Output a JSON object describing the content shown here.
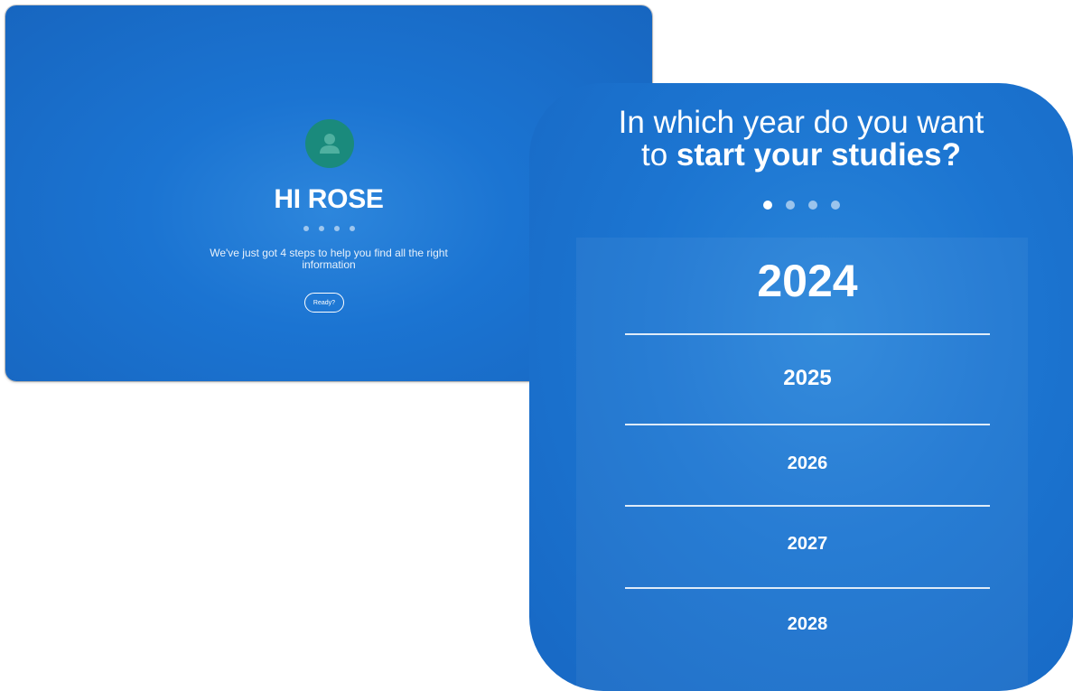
{
  "welcome": {
    "title": "HI ROSE",
    "message": "We've just got 4 steps to help you find all the right information",
    "ready_label": "Ready?",
    "steps": 4
  },
  "picker": {
    "question_line1": "In which year do you want",
    "question_line2_prefix": "to ",
    "question_line2_bold": "start your studies?",
    "steps": 4,
    "active_step": 1,
    "years": [
      "2024",
      "2025",
      "2026",
      "2027",
      "2028"
    ],
    "selected_year": "2024"
  },
  "colors": {
    "background_blue": "#1b74d2",
    "avatar_teal": "#1a8a7c"
  },
  "icons": {
    "avatar": "person-icon"
  }
}
